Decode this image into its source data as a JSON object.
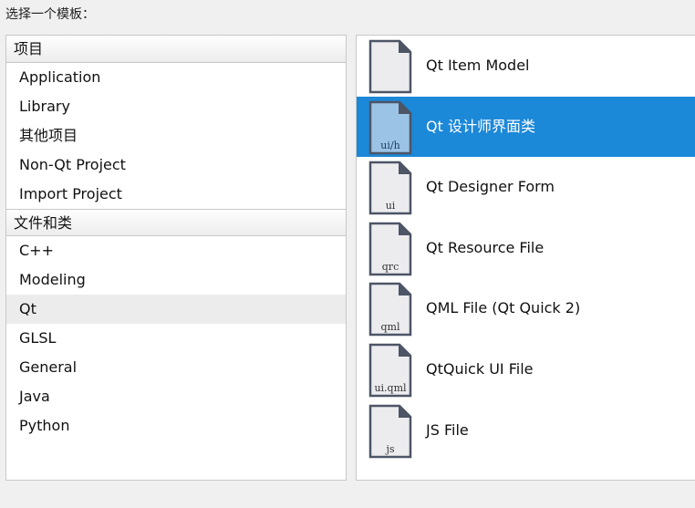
{
  "prompt": "选择一个模板：",
  "categories": {
    "group1": {
      "header": "项目",
      "items": [
        "Application",
        "Library",
        "其他项目",
        "Non-Qt Project",
        "Import Project"
      ]
    },
    "group2": {
      "header": "文件和类",
      "items": [
        "C++",
        "Modeling",
        "Qt",
        "GLSL",
        "General",
        "Java",
        "Python"
      ]
    },
    "selected": "Qt"
  },
  "templates": [
    {
      "label": "Qt Item Model",
      "ext": ""
    },
    {
      "label": "Qt 设计师界面类",
      "ext": "ui/h"
    },
    {
      "label": "Qt Designer Form",
      "ext": "ui"
    },
    {
      "label": "Qt Resource File",
      "ext": "qrc"
    },
    {
      "label": "QML File (Qt Quick 2)",
      "ext": "qml"
    },
    {
      "label": "QtQuick UI File",
      "ext": "ui.qml"
    },
    {
      "label": "JS File",
      "ext": "js"
    }
  ],
  "selected_template": "Qt 设计师界面类",
  "colors": {
    "selection": "#1c88d8",
    "icon_fill": "#ececef",
    "icon_fill_selected": "#9bc3e6",
    "icon_border": "#4d5566"
  }
}
